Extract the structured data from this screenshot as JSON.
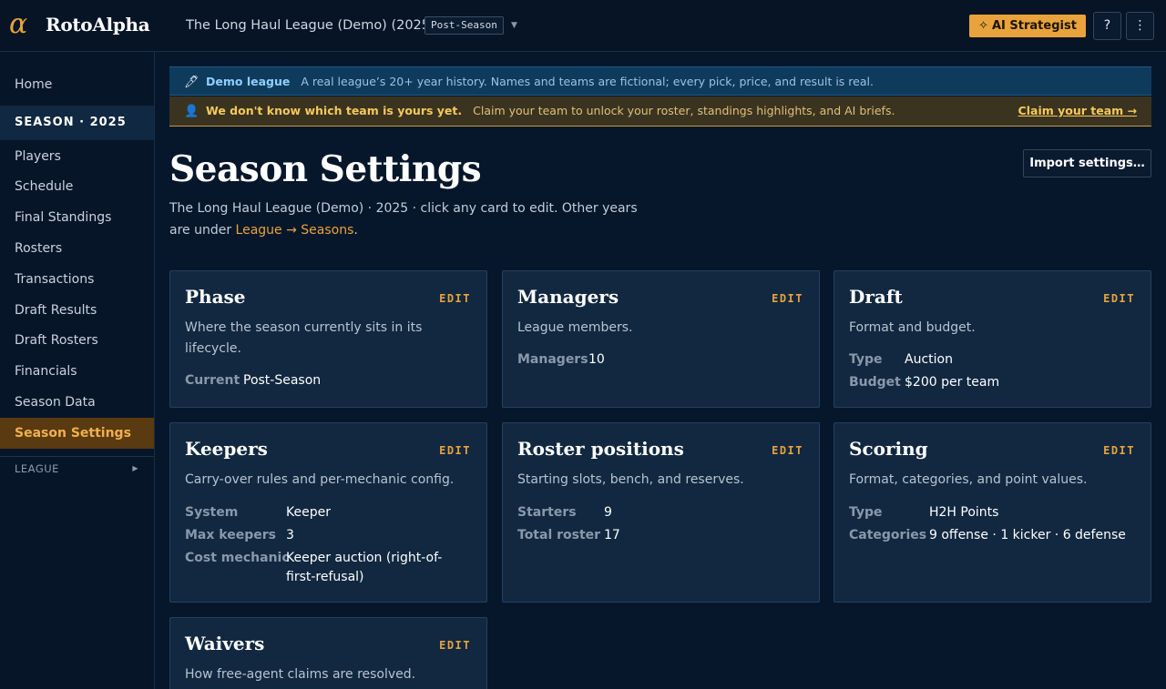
{
  "header": {
    "logo_glyph": "α",
    "app_name": "RotoAlpha",
    "league_name": "The Long Haul League (Demo) (2025)",
    "phase": "Post-Season",
    "ai_label": "AI Strategist",
    "help_label": "?",
    "menu_label": "⋮",
    "accent": "#e8a33c"
  },
  "sidebar": {
    "home": "Home",
    "section": "SEASON · 2025",
    "items": [
      "Players",
      "Schedule",
      "Final Standings",
      "Rosters",
      "Transactions",
      "Draft Results",
      "Draft Rosters",
      "Financials",
      "Season Data",
      "Season Settings"
    ],
    "active": "Season Settings",
    "league": "LEAGUE"
  },
  "banners": {
    "demo_lead": "Demo league",
    "demo_msg": "A real league’s 20+ year history. Names and teams are fictional; every pick, price, and result is real.",
    "claim_lead": "We don't know which team is yours yet.",
    "claim_msg": "Claim your team to unlock your roster, standings highlights, and AI briefs.",
    "claim_link": "Claim your team →"
  },
  "page": {
    "title": "Season Settings",
    "import_label": "Import settings…",
    "subtitle_prefix": "The Long Haul League (Demo) · 2025 · click any card to edit. Other years are under ",
    "subtitle_link": "League → Seasons",
    "subtitle_suffix": "."
  },
  "cards": {
    "edit_label": "EDIT",
    "phase": {
      "title": "Phase",
      "desc": "Where the season currently sits in its lifecycle.",
      "rows": [
        {
          "k": "Current",
          "v": "Post-Season"
        }
      ]
    },
    "managers": {
      "title": "Managers",
      "desc": "League members.",
      "rows": [
        {
          "k": "Managers",
          "v": "10"
        }
      ]
    },
    "draft": {
      "title": "Draft",
      "desc": "Format and budget.",
      "rows": [
        {
          "k": "Type",
          "v": "Auction"
        },
        {
          "k": "Budget",
          "v": "$200 per team"
        }
      ]
    },
    "keepers": {
      "title": "Keepers",
      "desc": "Carry-over rules and per-mechanic config.",
      "rows": [
        {
          "k": "System",
          "v": "Keeper"
        },
        {
          "k": "Max keepers",
          "v": "3"
        },
        {
          "k": "Cost mechanic",
          "v": "Keeper auction (right-of-first-refusal)"
        }
      ]
    },
    "roster": {
      "title": "Roster positions",
      "desc": "Starting slots, bench, and reserves.",
      "rows": [
        {
          "k": "Starters",
          "v": "9"
        },
        {
          "k": "Total roster",
          "v": "17"
        }
      ]
    },
    "scoring": {
      "title": "Scoring",
      "desc": "Format, categories, and point values.",
      "rows": [
        {
          "k": "Type",
          "v": "H2H Points"
        },
        {
          "k": "Categories",
          "v": "9 offense · 1 kicker · 6 defense"
        }
      ]
    },
    "waivers": {
      "title": "Waivers",
      "desc": "How free-agent claims are resolved."
    }
  }
}
